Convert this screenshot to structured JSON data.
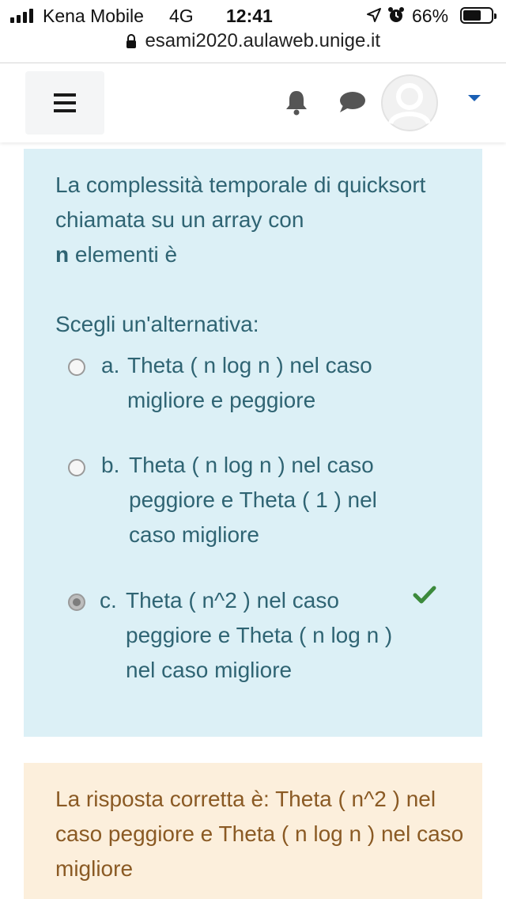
{
  "status_bar": {
    "carrier": "Kena Mobile",
    "network": "4G",
    "time": "12:41",
    "battery": "66%",
    "battery_level": 0.66
  },
  "browser": {
    "url": "esami2020.aulaweb.unige.it"
  },
  "question": {
    "text_before_bold": "La complessità temporale di quicksort chiamata su un array con",
    "bold_var": "n",
    "text_after_bold": " elementi è",
    "prompt": "Scegli un'alternativa:",
    "answers": [
      {
        "letter": "a.",
        "text": "Theta ( n log n ) nel caso migliore e peggiore",
        "selected": false
      },
      {
        "letter": "b.",
        "text": "Theta ( n log n ) nel caso peggiore e Theta ( 1 ) nel caso migliore",
        "selected": false
      },
      {
        "letter": "c.",
        "text": "Theta ( n^2 ) nel caso peggiore e Theta ( n log n ) nel caso migliore",
        "selected": true
      }
    ]
  },
  "feedback": {
    "text": "La risposta corretta è: Theta ( n^2 ) nel caso peggiore e Theta ( n log n ) nel caso migliore"
  },
  "colors": {
    "question_bg": "#dcf0f6",
    "question_text": "#2f6473",
    "feedback_bg": "#fcefdc",
    "feedback_text": "#8a5a24",
    "correct_check": "#3c8a3c",
    "caret": "#1a5fb4"
  },
  "icons": {
    "menu": "hamburger-icon",
    "notifications": "bell-icon",
    "messages": "chat-icon",
    "user": "avatar",
    "correct": "check-icon"
  }
}
